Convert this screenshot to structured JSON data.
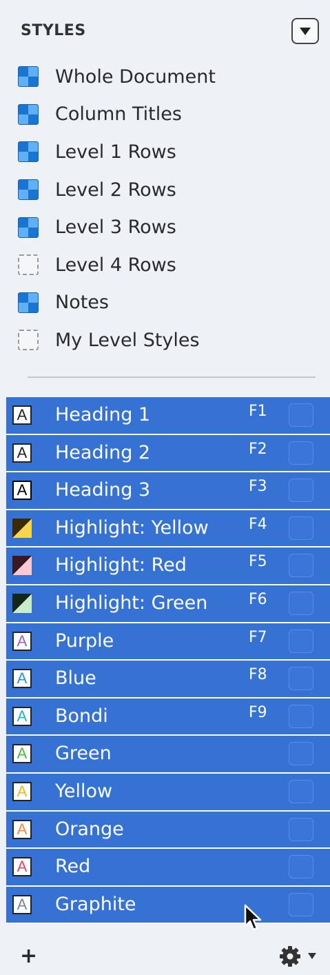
{
  "header": {
    "title": "STYLES",
    "menu_icon": "dropdown-triangle-icon"
  },
  "level_styles": [
    {
      "label": "Whole Document",
      "icon": "blue-style-swatch"
    },
    {
      "label": "Column Titles",
      "icon": "blue-style-swatch"
    },
    {
      "label": "Level 1 Rows",
      "icon": "blue-style-swatch"
    },
    {
      "label": "Level 2 Rows",
      "icon": "blue-style-swatch"
    },
    {
      "label": "Level 3 Rows",
      "icon": "blue-style-swatch"
    },
    {
      "label": "Level 4 Rows",
      "icon": "empty-style-swatch"
    },
    {
      "label": "Notes",
      "icon": "blue-style-swatch"
    },
    {
      "label": "My Level Styles",
      "icon": "empty-style-swatch"
    }
  ],
  "named_styles": [
    {
      "label": "Heading 1",
      "key": "F1",
      "glyph": "A",
      "kind": "text",
      "glyph_color": "#222222",
      "border": "#222222"
    },
    {
      "label": "Heading 2",
      "key": "F2",
      "glyph": "A",
      "kind": "text",
      "glyph_color": "#222222",
      "border": "#222222"
    },
    {
      "label": "Heading 3",
      "key": "F3",
      "glyph": "A",
      "kind": "text",
      "glyph_color": "#000000",
      "border": "#000000"
    },
    {
      "label": "Highlight: Yellow",
      "key": "F4",
      "glyph": "",
      "kind": "diag",
      "dark": "#3a2a06",
      "light": "#f8d64a"
    },
    {
      "label": "Highlight: Red",
      "key": "F5",
      "glyph": "",
      "kind": "diag",
      "dark": "#3a1a22",
      "light": "#fbc9d2"
    },
    {
      "label": "Highlight: Green",
      "key": "F6",
      "glyph": "",
      "kind": "diag",
      "dark": "#14261a",
      "light": "#c9ecc9"
    },
    {
      "label": "Purple",
      "key": "F7",
      "glyph": "A",
      "kind": "text",
      "glyph_color": "#9a5ed4",
      "border": "#222222"
    },
    {
      "label": "Blue",
      "key": "F8",
      "glyph": "A",
      "kind": "text",
      "glyph_color": "#2f8ee8",
      "border": "#222222"
    },
    {
      "label": "Bondi",
      "key": "F9",
      "glyph": "A",
      "kind": "text",
      "glyph_color": "#1fb6bf",
      "border": "#222222"
    },
    {
      "label": "Green",
      "key": "",
      "glyph": "A",
      "kind": "text",
      "glyph_color": "#4cb84a",
      "border": "#222222"
    },
    {
      "label": "Yellow",
      "key": "",
      "glyph": "A",
      "kind": "text",
      "glyph_color": "#f2b71c",
      "border": "#222222"
    },
    {
      "label": "Orange",
      "key": "",
      "glyph": "A",
      "kind": "text",
      "glyph_color": "#f28a3c",
      "border": "#222222"
    },
    {
      "label": "Red",
      "key": "",
      "glyph": "A",
      "kind": "text",
      "glyph_color": "#e8475a",
      "border": "#222222"
    },
    {
      "label": "Graphite",
      "key": "",
      "glyph": "A",
      "kind": "text",
      "glyph_color": "#7a8494",
      "border": "#222222"
    }
  ],
  "footer": {
    "add_label": "+",
    "add_icon": "plus-icon",
    "settings_icon": "gear-icon"
  },
  "colors": {
    "selection": "#3572d4",
    "panel_background": "#eef2f6"
  }
}
